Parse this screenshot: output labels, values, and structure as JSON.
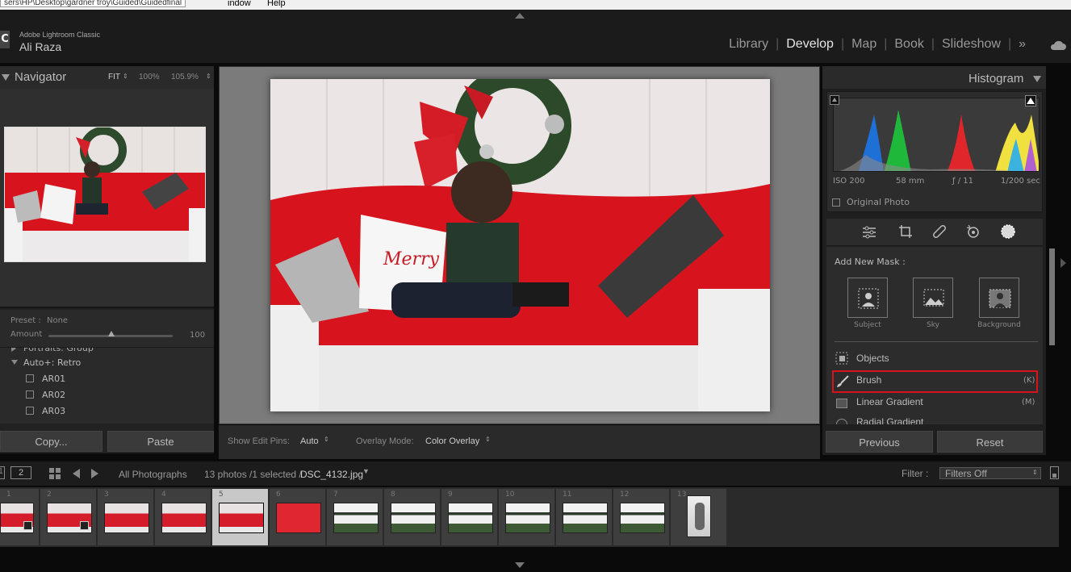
{
  "window": {
    "path_fragment": "sers\\HP\\Desktop\\gardner troy\\Guided\\Guidedfinal",
    "menu_window": "indow",
    "menu_help": "Help"
  },
  "identity": {
    "logo": "C",
    "app_name": "Adobe Lightroom Classic",
    "user": "Ali Raza"
  },
  "modules": [
    "Library",
    "Develop",
    "Map",
    "Book",
    "Slideshow"
  ],
  "modules_active": "Develop",
  "module_more": "»",
  "navigator": {
    "title": "Navigator",
    "zoom_fit": "FIT",
    "zoom_100": "100%",
    "zoom_other": "105.9%"
  },
  "presets": {
    "preset_label": "Preset :",
    "preset_value": "None",
    "amount_label": "Amount",
    "amount_value": "100",
    "amount_fraction": 0.5,
    "group_partial": "Portraits: Group",
    "group": "Auto+: Retro",
    "items": [
      "AR01",
      "AR02",
      "AR03"
    ]
  },
  "center_toolbar": {
    "pins_label": "Show Edit Pins:",
    "pins_value": "Auto",
    "overlay_label": "Overlay Mode:",
    "overlay_value": "Color Overlay"
  },
  "left_buttons": {
    "copy": "Copy...",
    "paste": "Paste"
  },
  "histogram": {
    "title": "Histogram",
    "iso": "ISO 200",
    "focal": "58 mm",
    "aperture": "ƒ / 11",
    "shutter": "1/200 sec",
    "original_photo": "Original Photo"
  },
  "mask_panel": {
    "add_new_mask": "Add New Mask :",
    "subject": "Subject",
    "sky": "Sky",
    "background": "Background",
    "objects": "Objects",
    "brush": "Brush",
    "brush_key": "(K)",
    "linear": "Linear Gradient",
    "linear_key": "(M)",
    "radial_partial": "Radial Gradient"
  },
  "right_buttons": {
    "previous": "Previous",
    "reset": "Reset"
  },
  "filmstrip_bar": {
    "page1": "1",
    "page2": "2",
    "source": "All Photographs",
    "count": "13 photos /1 selected /",
    "filename": "DSC_4132.jpg",
    "filter_label": "Filter :",
    "filter_value": "Filters Off"
  },
  "filmstrip": [
    "1",
    "2",
    "3",
    "4",
    "5",
    "6",
    "7",
    "8",
    "9",
    "10",
    "11",
    "12",
    "13"
  ],
  "colors": {
    "accent_red": "#d7141e",
    "bg_dark": "#1f1f1f"
  }
}
